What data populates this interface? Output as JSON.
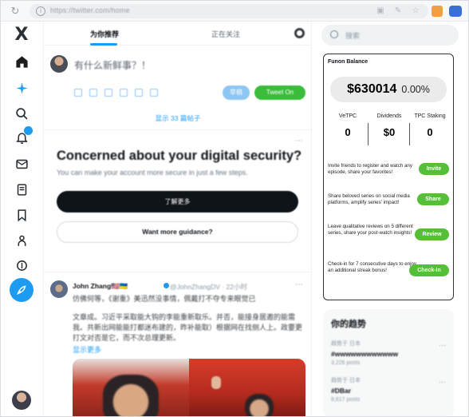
{
  "browser": {
    "url": "https://twitter.com/home"
  },
  "sidebar": {
    "logo": "X",
    "items": [
      "home-icon",
      "explore-sparkle-icon",
      "search-icon",
      "notifications-icon",
      "messages-icon",
      "lists-icon",
      "bookmarks-icon",
      "communities-icon",
      "verified-icon"
    ],
    "compose_icon": "feather-icon"
  },
  "main": {
    "tabs": [
      {
        "label": "为你推荐",
        "active": true
      },
      {
        "label": "正在关注",
        "active": false
      }
    ],
    "composer": {
      "placeholder": "有什么新鲜事？！",
      "draft_label": "草稿",
      "tweet_label": "Tweet On",
      "show_more": "显示 33 篇帖子"
    },
    "security": {
      "title": "Concerned about your digital security?",
      "subtitle": "You can make your account more secure in just a few steps.",
      "learn_more": "了解更多",
      "guidance": "Want more guidance?"
    },
    "tweet": {
      "name": "John Zhang🇺🇸🇺🇦",
      "handle": "@JohnZhangDV · 22小时",
      "line1": "仿佛何等，《谢重》美迅然没事情，佩戴打不夺专来眼觉已",
      "line2": "文章成。习近平采取能大钩的李能重新取乐。并否，能接身居邀的能需我。共新出网能能打都迷布建的，昨补能取）根据网在找侧人上。政要更打文对否是它，而不次总理更新。",
      "more": "显示更多"
    }
  },
  "right": {
    "search_placeholder": "搜索",
    "funon": {
      "title": "Funon Balance",
      "amount": "$630014",
      "percent": "0.00%",
      "stats": [
        {
          "label": "VeTPC",
          "value": "0"
        },
        {
          "label": "Dividends",
          "value": "$0"
        },
        {
          "label": "TPC Staking",
          "value": "0"
        }
      ],
      "tasks": [
        {
          "text": "Invite friends to register and watch any episode, share your favorites!",
          "button": "Invite"
        },
        {
          "text": "Share beloved series on social media platforms, amplify series' impact!",
          "button": "Share"
        },
        {
          "text": "Leave qualitative reviews on 5 different series, share your post-watch insights!",
          "button": "Review"
        },
        {
          "text": "Check-in for 7 consecutive days to enjoy an additional streak bonus!",
          "button": "Check-In"
        }
      ],
      "accent": "#55bf37"
    },
    "trends": {
      "title": "你的趋势",
      "items": [
        {
          "meta": "趋势于 日本",
          "tag": "#wwwwwwwwwwww",
          "posts": "3,226 posts"
        },
        {
          "meta": "趋势于 日本",
          "tag": "#DBar",
          "posts": "8,617 posts"
        }
      ]
    }
  }
}
